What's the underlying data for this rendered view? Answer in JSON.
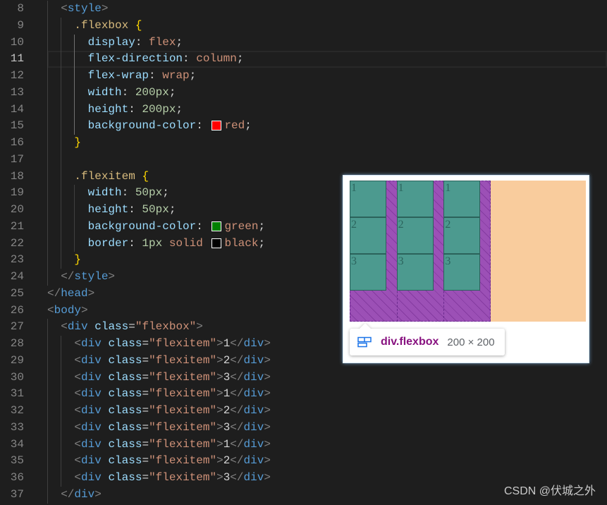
{
  "editor": {
    "active_line": 11,
    "lines": [
      {
        "n": 8,
        "tokens": [
          [
            "ws",
            "  "
          ],
          [
            "punct",
            "<"
          ],
          [
            "tag",
            "style"
          ],
          [
            "punct",
            ">"
          ]
        ]
      },
      {
        "n": 9,
        "tokens": [
          [
            "ws",
            "    "
          ],
          [
            "sel",
            ".flexbox"
          ],
          [
            "text",
            " "
          ],
          [
            "brace",
            "{"
          ]
        ]
      },
      {
        "n": 10,
        "tokens": [
          [
            "ws",
            "      "
          ],
          [
            "prop",
            "display"
          ],
          [
            "text",
            ": "
          ],
          [
            "val",
            "flex"
          ],
          [
            "text",
            ";"
          ]
        ]
      },
      {
        "n": 11,
        "tokens": [
          [
            "ws",
            "      "
          ],
          [
            "prop",
            "flex-direction"
          ],
          [
            "text",
            ": "
          ],
          [
            "val",
            "column"
          ],
          [
            "text",
            ";"
          ]
        ]
      },
      {
        "n": 12,
        "tokens": [
          [
            "ws",
            "      "
          ],
          [
            "prop",
            "flex-wrap"
          ],
          [
            "text",
            ": "
          ],
          [
            "val",
            "wrap"
          ],
          [
            "text",
            ";"
          ]
        ]
      },
      {
        "n": 13,
        "tokens": [
          [
            "ws",
            "      "
          ],
          [
            "prop",
            "width"
          ],
          [
            "text",
            ": "
          ],
          [
            "num",
            "200px"
          ],
          [
            "text",
            ";"
          ]
        ]
      },
      {
        "n": 14,
        "tokens": [
          [
            "ws",
            "      "
          ],
          [
            "prop",
            "height"
          ],
          [
            "text",
            ": "
          ],
          [
            "num",
            "200px"
          ],
          [
            "text",
            ";"
          ]
        ]
      },
      {
        "n": 15,
        "tokens": [
          [
            "ws",
            "      "
          ],
          [
            "prop",
            "background-color"
          ],
          [
            "text",
            ": "
          ],
          [
            "swatch",
            "#ff0000"
          ],
          [
            "val",
            "red"
          ],
          [
            "text",
            ";"
          ]
        ]
      },
      {
        "n": 16,
        "tokens": [
          [
            "ws",
            "    "
          ],
          [
            "brace",
            "}"
          ]
        ]
      },
      {
        "n": 17,
        "tokens": []
      },
      {
        "n": 18,
        "tokens": [
          [
            "ws",
            "    "
          ],
          [
            "sel",
            ".flexitem"
          ],
          [
            "text",
            " "
          ],
          [
            "brace",
            "{"
          ]
        ]
      },
      {
        "n": 19,
        "tokens": [
          [
            "ws",
            "      "
          ],
          [
            "prop",
            "width"
          ],
          [
            "text",
            ": "
          ],
          [
            "num",
            "50px"
          ],
          [
            "text",
            ";"
          ]
        ]
      },
      {
        "n": 20,
        "tokens": [
          [
            "ws",
            "      "
          ],
          [
            "prop",
            "height"
          ],
          [
            "text",
            ": "
          ],
          [
            "num",
            "50px"
          ],
          [
            "text",
            ";"
          ]
        ]
      },
      {
        "n": 21,
        "tokens": [
          [
            "ws",
            "      "
          ],
          [
            "prop",
            "background-color"
          ],
          [
            "text",
            ": "
          ],
          [
            "swatch",
            "#008000"
          ],
          [
            "val",
            "green"
          ],
          [
            "text",
            ";"
          ]
        ]
      },
      {
        "n": 22,
        "tokens": [
          [
            "ws",
            "      "
          ],
          [
            "prop",
            "border"
          ],
          [
            "text",
            ": "
          ],
          [
            "num",
            "1px"
          ],
          [
            "text",
            " "
          ],
          [
            "val",
            "solid"
          ],
          [
            "text",
            " "
          ],
          [
            "swatch",
            "#000000"
          ],
          [
            "val",
            "black"
          ],
          [
            "text",
            ";"
          ]
        ]
      },
      {
        "n": 23,
        "tokens": [
          [
            "ws",
            "    "
          ],
          [
            "brace",
            "}"
          ]
        ]
      },
      {
        "n": 24,
        "tokens": [
          [
            "ws",
            "  "
          ],
          [
            "punct",
            "</"
          ],
          [
            "tag",
            "style"
          ],
          [
            "punct",
            ">"
          ]
        ]
      },
      {
        "n": 25,
        "tokens": [
          [
            "punct",
            "</"
          ],
          [
            "tag",
            "head"
          ],
          [
            "punct",
            ">"
          ]
        ]
      },
      {
        "n": 26,
        "tokens": [
          [
            "punct",
            "<"
          ],
          [
            "tag",
            "body"
          ],
          [
            "punct",
            ">"
          ]
        ]
      },
      {
        "n": 27,
        "tokens": [
          [
            "ws",
            "  "
          ],
          [
            "punct",
            "<"
          ],
          [
            "tag",
            "div"
          ],
          [
            "text",
            " "
          ],
          [
            "attr",
            "class"
          ],
          [
            "text",
            "="
          ],
          [
            "str",
            "\"flexbox\""
          ],
          [
            "punct",
            ">"
          ]
        ]
      },
      {
        "n": 28,
        "tokens": [
          [
            "ws",
            "    "
          ],
          [
            "punct",
            "<"
          ],
          [
            "tag",
            "div"
          ],
          [
            "text",
            " "
          ],
          [
            "attr",
            "class"
          ],
          [
            "text",
            "="
          ],
          [
            "str",
            "\"flexitem\""
          ],
          [
            "punct",
            ">"
          ],
          [
            "text",
            "1"
          ],
          [
            "punct",
            "</"
          ],
          [
            "tag",
            "div"
          ],
          [
            "punct",
            ">"
          ]
        ]
      },
      {
        "n": 29,
        "tokens": [
          [
            "ws",
            "    "
          ],
          [
            "punct",
            "<"
          ],
          [
            "tag",
            "div"
          ],
          [
            "text",
            " "
          ],
          [
            "attr",
            "class"
          ],
          [
            "text",
            "="
          ],
          [
            "str",
            "\"flexitem\""
          ],
          [
            "punct",
            ">"
          ],
          [
            "text",
            "2"
          ],
          [
            "punct",
            "</"
          ],
          [
            "tag",
            "div"
          ],
          [
            "punct",
            ">"
          ]
        ]
      },
      {
        "n": 30,
        "tokens": [
          [
            "ws",
            "    "
          ],
          [
            "punct",
            "<"
          ],
          [
            "tag",
            "div"
          ],
          [
            "text",
            " "
          ],
          [
            "attr",
            "class"
          ],
          [
            "text",
            "="
          ],
          [
            "str",
            "\"flexitem\""
          ],
          [
            "punct",
            ">"
          ],
          [
            "text",
            "3"
          ],
          [
            "punct",
            "</"
          ],
          [
            "tag",
            "div"
          ],
          [
            "punct",
            ">"
          ]
        ]
      },
      {
        "n": 31,
        "tokens": [
          [
            "ws",
            "    "
          ],
          [
            "punct",
            "<"
          ],
          [
            "tag",
            "div"
          ],
          [
            "text",
            " "
          ],
          [
            "attr",
            "class"
          ],
          [
            "text",
            "="
          ],
          [
            "str",
            "\"flexitem\""
          ],
          [
            "punct",
            ">"
          ],
          [
            "text",
            "1"
          ],
          [
            "punct",
            "</"
          ],
          [
            "tag",
            "div"
          ],
          [
            "punct",
            ">"
          ]
        ]
      },
      {
        "n": 32,
        "tokens": [
          [
            "ws",
            "    "
          ],
          [
            "punct",
            "<"
          ],
          [
            "tag",
            "div"
          ],
          [
            "text",
            " "
          ],
          [
            "attr",
            "class"
          ],
          [
            "text",
            "="
          ],
          [
            "str",
            "\"flexitem\""
          ],
          [
            "punct",
            ">"
          ],
          [
            "text",
            "2"
          ],
          [
            "punct",
            "</"
          ],
          [
            "tag",
            "div"
          ],
          [
            "punct",
            ">"
          ]
        ]
      },
      {
        "n": 33,
        "tokens": [
          [
            "ws",
            "    "
          ],
          [
            "punct",
            "<"
          ],
          [
            "tag",
            "div"
          ],
          [
            "text",
            " "
          ],
          [
            "attr",
            "class"
          ],
          [
            "text",
            "="
          ],
          [
            "str",
            "\"flexitem\""
          ],
          [
            "punct",
            ">"
          ],
          [
            "text",
            "3"
          ],
          [
            "punct",
            "</"
          ],
          [
            "tag",
            "div"
          ],
          [
            "punct",
            ">"
          ]
        ]
      },
      {
        "n": 34,
        "tokens": [
          [
            "ws",
            "    "
          ],
          [
            "punct",
            "<"
          ],
          [
            "tag",
            "div"
          ],
          [
            "text",
            " "
          ],
          [
            "attr",
            "class"
          ],
          [
            "text",
            "="
          ],
          [
            "str",
            "\"flexitem\""
          ],
          [
            "punct",
            ">"
          ],
          [
            "text",
            "1"
          ],
          [
            "punct",
            "</"
          ],
          [
            "tag",
            "div"
          ],
          [
            "punct",
            ">"
          ]
        ]
      },
      {
        "n": 35,
        "tokens": [
          [
            "ws",
            "    "
          ],
          [
            "punct",
            "<"
          ],
          [
            "tag",
            "div"
          ],
          [
            "text",
            " "
          ],
          [
            "attr",
            "class"
          ],
          [
            "text",
            "="
          ],
          [
            "str",
            "\"flexitem\""
          ],
          [
            "punct",
            ">"
          ],
          [
            "text",
            "2"
          ],
          [
            "punct",
            "</"
          ],
          [
            "tag",
            "div"
          ],
          [
            "punct",
            ">"
          ]
        ]
      },
      {
        "n": 36,
        "tokens": [
          [
            "ws",
            "    "
          ],
          [
            "punct",
            "<"
          ],
          [
            "tag",
            "div"
          ],
          [
            "text",
            " "
          ],
          [
            "attr",
            "class"
          ],
          [
            "text",
            "="
          ],
          [
            "str",
            "\"flexitem\""
          ],
          [
            "punct",
            ">"
          ],
          [
            "text",
            "3"
          ],
          [
            "punct",
            "</"
          ],
          [
            "tag",
            "div"
          ],
          [
            "punct",
            ">"
          ]
        ]
      },
      {
        "n": 37,
        "tokens": [
          [
            "ws",
            "  "
          ],
          [
            "punct",
            "</"
          ],
          [
            "tag",
            "div"
          ],
          [
            "punct",
            ">"
          ]
        ]
      }
    ]
  },
  "theme": {
    "background": "#1e1e1e",
    "line_number": "#858585",
    "line_number_active": "#c6c6c6",
    "text": "#d4d4d4",
    "punct": "#808080",
    "tag": "#569cd6",
    "sel": "#d7ba7d",
    "brace": "#ffd700",
    "prop": "#9cdcfe",
    "attr": "#9cdcfe",
    "val": "#ce9178",
    "str": "#ce9178",
    "num": "#b5cea8"
  },
  "preview": {
    "items": [
      "1",
      "2",
      "3",
      "1",
      "2",
      "3",
      "1",
      "2",
      "3"
    ],
    "colors": {
      "container": "#9c50b6",
      "item": "#4c9a8f",
      "margin": "#f9cc9d"
    },
    "tooltip": {
      "icon": "flex-container-icon",
      "selector": "div.flexbox",
      "size": "200 × 200"
    }
  },
  "watermark": "CSDN @伏城之外"
}
